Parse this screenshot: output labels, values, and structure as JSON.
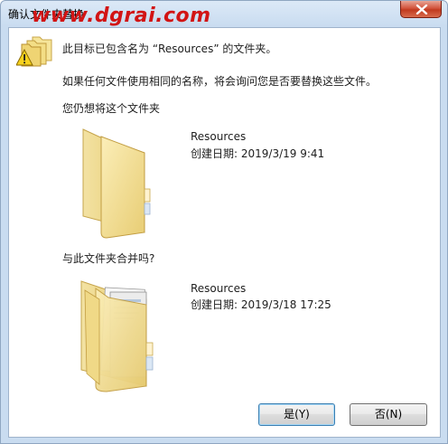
{
  "window": {
    "title": "确认文件夹替换",
    "watermark": "www.dgrai.com"
  },
  "dialog": {
    "message_line1": "此目标已包含名为 “Resources” 的文件夹。",
    "message_line2": "如果任何文件使用相同的名称，将会询问您是否要替换这些文件。",
    "prompt_keep": "您仍想将这个文件夹",
    "existing_folder": {
      "name": "Resources",
      "created": "创建日期: 2019/3/19 9:41"
    },
    "prompt_merge": "与此文件夹合并吗?",
    "incoming_folder": {
      "name": "Resources",
      "created": "创建日期: 2019/3/18 17:25"
    }
  },
  "buttons": {
    "yes": "是(Y)",
    "no": "否(N)"
  },
  "icons": [
    "warning-folder-icon",
    "close-icon",
    "empty-folder-icon",
    "full-folder-icon"
  ]
}
